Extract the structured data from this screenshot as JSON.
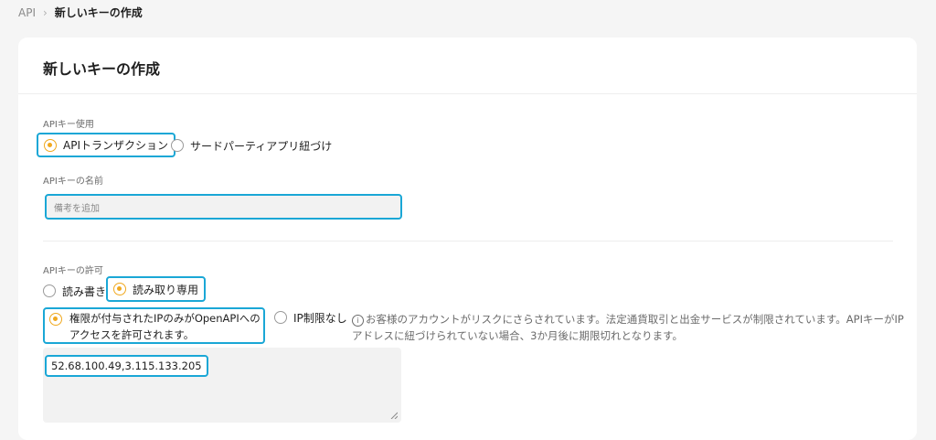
{
  "breadcrumb": {
    "root": "API",
    "current": "新しいキーの作成"
  },
  "card": {
    "title": "新しいキーの作成"
  },
  "usage": {
    "label": "APIキー使用",
    "options": [
      {
        "label": "APIトランザクション",
        "checked": true
      },
      {
        "label": "サードパーティアプリ紐づけ",
        "checked": false
      }
    ]
  },
  "name": {
    "label": "APIキーの名前",
    "placeholder": "備考を追加"
  },
  "permission": {
    "label": "APIキーの許可",
    "options": [
      {
        "label": "読み書き",
        "checked": false
      },
      {
        "label": "読み取り専用",
        "checked": true
      }
    ]
  },
  "ip": {
    "restricted_label_line1": "権限が付与されたIPのみがOpenAPIへの",
    "restricted_label_line2": "アクセスを許可されます。",
    "unrestricted_label": "IP制限なし",
    "warning_icon": "i",
    "warning_text": "お客様のアカウントがリスクにさらされています。法定通貨取引と出金サービスが制限されています。APIキーがIPアドレスに紐づけられていない場合、3か月後に期限切れとなります。",
    "value": "52.68.100.49,3.115.133.205"
  },
  "colors": {
    "accent": "#f0a81e",
    "highlight": "#1aa7d6"
  }
}
